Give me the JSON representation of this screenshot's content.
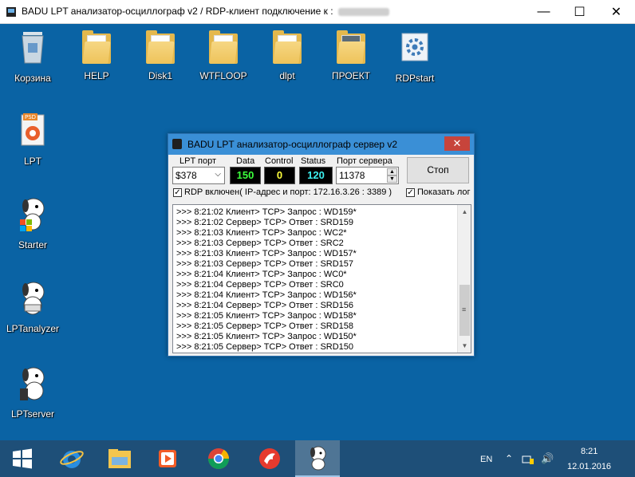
{
  "window": {
    "title": "BADU LPT анализатор-осциллограф v2 / RDP-клиент подключение к :",
    "minimize_glyph": "—",
    "maximize_glyph": "☐",
    "close_glyph": "✕"
  },
  "desktop": {
    "icons": [
      {
        "label": "Корзина",
        "icon": "recycle-bin-icon"
      },
      {
        "label": "HELP",
        "icon": "folder-icon"
      },
      {
        "label": "Disk1",
        "icon": "folder-icon"
      },
      {
        "label": "WTFLOOP",
        "icon": "folder-icon"
      },
      {
        "label": "dlpt",
        "icon": "folder-icon"
      },
      {
        "label": "ПРОЕКТ",
        "icon": "folder-icon"
      },
      {
        "label": "RDPstart",
        "icon": "gear-shortcut-icon"
      },
      {
        "label": "LPT",
        "icon": "psd-file-icon"
      },
      {
        "label": "Starter",
        "icon": "dog-mascot-icon"
      },
      {
        "label": "LPTanalyzer",
        "icon": "dog-mascot-icon"
      },
      {
        "label": "LPTserver",
        "icon": "dog-mascot-icon"
      }
    ]
  },
  "app": {
    "title": "BADU LPT анализатор-осциллограф сервер v2",
    "close_glyph": "✕",
    "lpt_port_label": "LPT порт",
    "lpt_port_value": "$378",
    "data_label": "Data",
    "data_value": "150",
    "control_label": "Control",
    "control_value": "0",
    "status_label": "Status",
    "status_value": "120",
    "server_port_label": "Порт сервера",
    "server_port_value": "11378",
    "stop_label": "Стоп",
    "rdp_checkbox_label": "RDP включен( IP-адрес и порт: 172.16.3.26 : 3389 )",
    "show_log_label": "Показать лог",
    "colors": {
      "data": "#3cff3c",
      "control": "#ffff3c",
      "status": "#3cf0f0"
    },
    "log": [
      ">>> 8:21:02 Клиент> TCP> Запрос : WD159*",
      ">>> 8:21:02 Сервер> TCP> Ответ : SRD159",
      ">>> 8:21:03 Клиент> TCP> Запрос : WC2*",
      ">>> 8:21:03 Сервер> TCP> Ответ : SRC2",
      ">>> 8:21:03 Клиент> TCP> Запрос : WD157*",
      ">>> 8:21:03 Сервер> TCP> Ответ : SRD157",
      ">>> 8:21:04 Клиент> TCP> Запрос : WC0*",
      ">>> 8:21:04 Сервер> TCP> Ответ : SRC0",
      ">>> 8:21:04 Клиент> TCP> Запрос : WD156*",
      ">>> 8:21:04 Сервер> TCP> Ответ : SRD156",
      ">>> 8:21:05 Клиент> TCP> Запрос : WD158*",
      ">>> 8:21:05 Сервер> TCP> Ответ : SRD158",
      ">>> 8:21:05 Клиент> TCP> Запрос : WD150*",
      ">>> 8:21:05 Сервер> TCP> Ответ : SRD150"
    ]
  },
  "taskbar": {
    "apps": [
      "start-button",
      "internet-explorer-icon",
      "file-explorer-icon",
      "media-player-icon",
      "chrome-icon",
      "redbird-app-icon",
      "dog-mascot-icon"
    ],
    "language": "EN",
    "time": "8:21",
    "date": "12.01.2016"
  }
}
